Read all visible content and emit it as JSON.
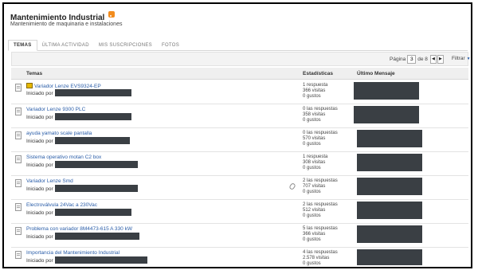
{
  "forum": {
    "title": "Mantenimiento Industrial",
    "description": "Mantenimiento de maquinaria e instalaciones"
  },
  "tabs": [
    "TEMAS",
    "ÚLTIMA ACTIVIDAD",
    "MIS SUSCRIPCIONES",
    "FOTOS"
  ],
  "pager": {
    "label": "Página",
    "current": "3",
    "of": "de 8",
    "filter": "Filtrar"
  },
  "columns": {
    "topics": "Temas",
    "stats": "Estadísticas",
    "last": "Último Mensaje"
  },
  "started_by_label": "Iniciado por",
  "threads": [
    {
      "title": "Variador Lenze EVS9324-EP",
      "stat1": "1 respuesta",
      "stat2": "366 visitas",
      "stat3": "0 gustos"
    },
    {
      "title": "Variador Lenze 9300 PLC",
      "stat1": "0 las respuestas",
      "stat2": "358 visitas",
      "stat3": "0 gustos"
    },
    {
      "title": "ayuda yamato scale pantalla",
      "stat1": "0 las respuestas",
      "stat2": "570 visitas",
      "stat3": "0 gustos"
    },
    {
      "title": "Sistema operativo motan C2 box",
      "stat1": "1 respuesta",
      "stat2": "308 visitas",
      "stat3": "0 gustos"
    },
    {
      "title": "Variador Lenze Smd",
      "stat1": "2 las respuestas",
      "stat2": "707 visitas",
      "stat3": "0 gustos"
    },
    {
      "title": "Electroválvula 24Vac a 230Vac",
      "stat1": "2 las respuestas",
      "stat2": "512 visitas",
      "stat3": "0 gustos"
    },
    {
      "title": "Problema con variador 8M4473-615 A 330 kW",
      "stat1": "5 las respuestas",
      "stat2": "366 visitas",
      "stat3": "0 gustos"
    },
    {
      "title": "Importancia del Mantenimiento Industrial",
      "stat1": "4 las respuestas",
      "stat2": "2.578 visitas",
      "stat3": "0 gustos"
    }
  ]
}
